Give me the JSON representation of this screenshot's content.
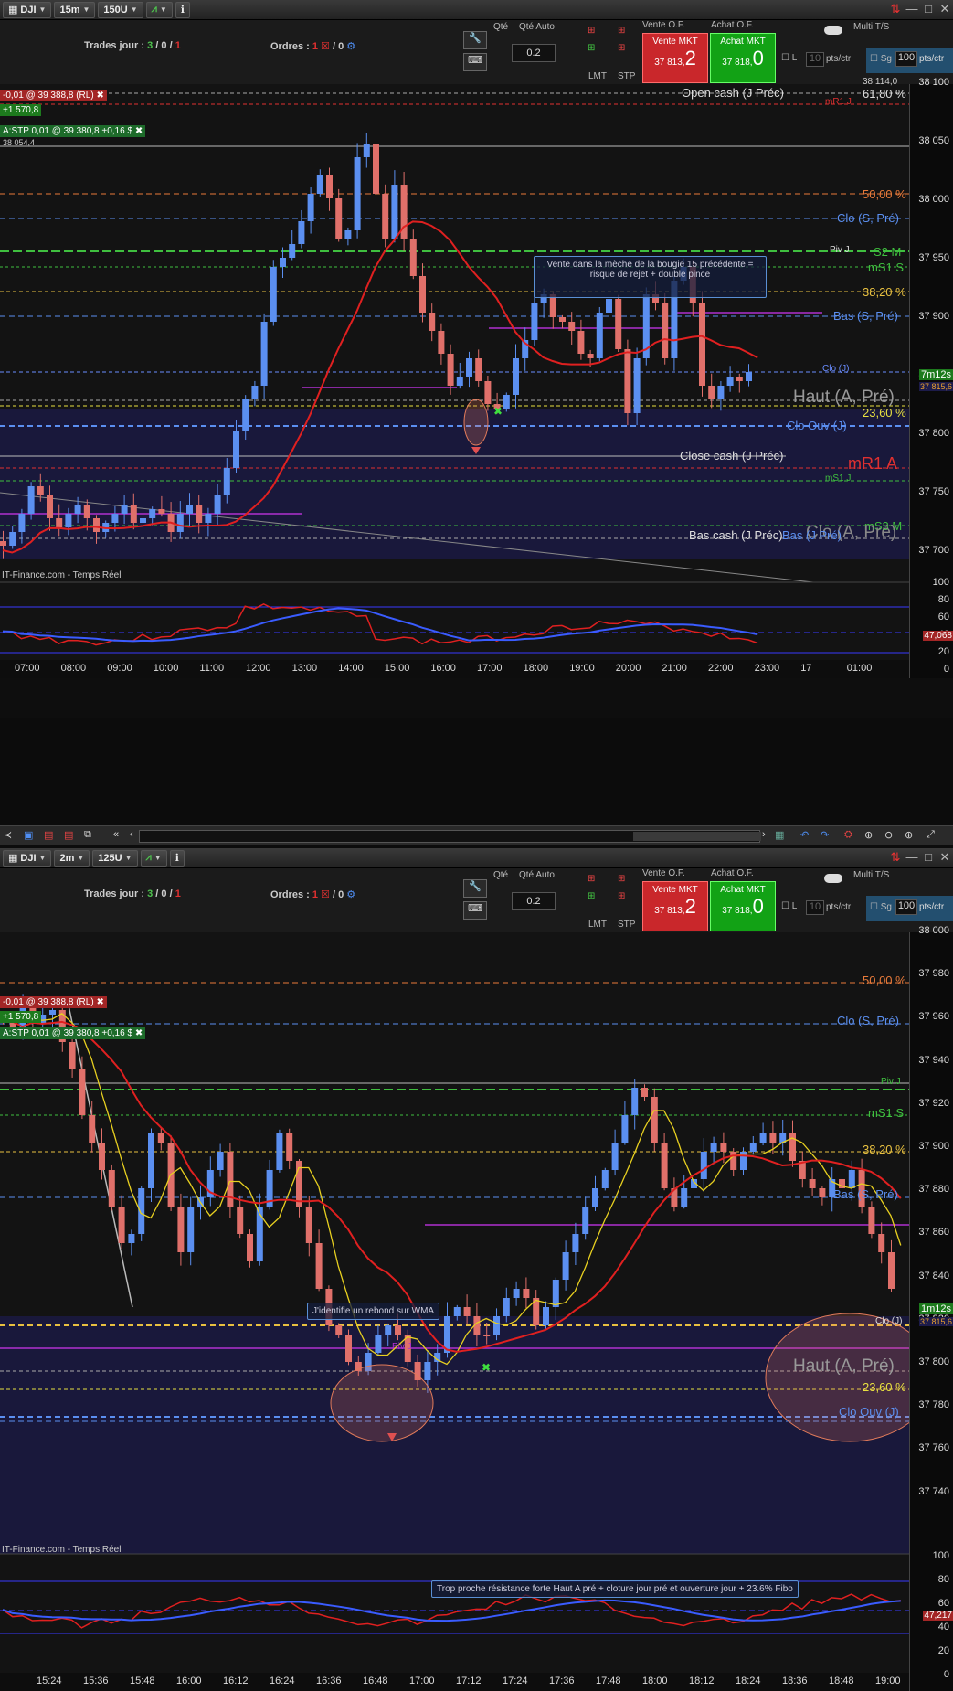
{
  "panes": [
    {
      "id": "top",
      "symbol": "DJI",
      "timeframe": "15m",
      "units": "150U",
      "trades_label": "Trades jour :",
      "trades_val1": "3",
      "trades_val2": "0",
      "trades_val3": "1",
      "orders_label": "Ordres :",
      "orders_val1": "1",
      "orders_val2": "0",
      "qty_label": "Qté",
      "qty_auto_label": "Qté Auto",
      "qty_value": "0.2",
      "lmt": "LMT",
      "stp": "STP",
      "vente_of": "Vente O.F.",
      "achat_of": "Achat O.F.",
      "vente_mkt": "Vente MKT",
      "achat_mkt": "Achat MKT",
      "vente_price": "37 813,",
      "vente_big": "2",
      "achat_price": "37 818,",
      "achat_big": "0",
      "multi": "Multi T/S",
      "l_label": "L",
      "l_val": "10",
      "pts": "pts/ctr",
      "sg": "Sg",
      "sg_val": "100",
      "pos1": "-0,01 @ 39 388,8 (RL)",
      "pos2": "+1 570,8",
      "pos3": "A:STP 0,01 @ 39 380,8",
      "pos3b": "+0,16 $",
      "pos4": "38 054,4",
      "price_ticks": [
        "38 100",
        "38 050",
        "38 000",
        "37 950",
        "37 900",
        "37 850",
        "37 800",
        "37 750",
        "37 700",
        "37 650"
      ],
      "levels": {
        "open_cash": "Open cash (J Préc)",
        "fib618": "61,80 %",
        "mr1j": "mR1 J",
        "fib50": "50,00 %",
        "clo_s": "Clo (S, Pré)",
        "pivj": "Piv J",
        "s2m": "S2 M",
        "ms1s": "mS1 S",
        "fib382": "38,20 %",
        "bas_s": "Bas (S, Pré)",
        "cloj": "Clo (J)",
        "haut_a": "Haut (A, Pré)",
        "fib236": "23,60 %",
        "clo_ouv": "Clo Ouv (J)",
        "close_cash": "Close cash (J Préc)",
        "mr1a": "mR1 A",
        "ms1j": "mS1 J",
        "ms3m": "mS3 M",
        "bas_cash": "Bas cash (J Préc)",
        "bas_j": "Bas (J Pré)",
        "clo_a": "Clo (A, Pré)",
        "price_tag": "37 815,6",
        "timer": "7m12s",
        "top_val": "38 114,0"
      },
      "note": "Vente dans la mèche de la bougie 15 précédente = risque de rejet + double pince",
      "credit": "IT-Finance.com - Temps Réel",
      "ind_ticks": [
        "100",
        "80",
        "60",
        "40",
        "20",
        "0"
      ],
      "ind_val": "47,068",
      "x_ticks": [
        "07:00",
        "08:00",
        "09:00",
        "10:00",
        "11:00",
        "12:00",
        "13:00",
        "14:00",
        "15:00",
        "16:00",
        "17:00",
        "18:00",
        "19:00",
        "20:00",
        "21:00",
        "22:00",
        "23:00",
        "17",
        "01:00"
      ]
    },
    {
      "id": "bottom",
      "symbol": "DJI",
      "timeframe": "2m",
      "units": "125U",
      "trades_label": "Trades jour :",
      "trades_val1": "3",
      "trades_val2": "0",
      "trades_val3": "1",
      "orders_label": "Ordres :",
      "orders_val1": "1",
      "orders_val2": "0",
      "qty_label": "Qté",
      "qty_auto_label": "Qté Auto",
      "qty_value": "0.2",
      "lmt": "LMT",
      "stp": "STP",
      "vente_of": "Vente O.F.",
      "achat_of": "Achat O.F.",
      "vente_mkt": "Vente MKT",
      "achat_mkt": "Achat MKT",
      "vente_price": "37 813,",
      "vente_big": "2",
      "achat_price": "37 818,",
      "achat_big": "0",
      "multi": "Multi T/S",
      "l_label": "L",
      "l_val": "10",
      "pts": "pts/ctr",
      "sg": "Sg",
      "sg_val": "100",
      "pos1": "-0,01 @ 39 388,8 (RL)",
      "pos2": "+1 570,8",
      "pos3": "A:STP 0,01 @ 39 380,8",
      "pos3b": "+0,16 $",
      "pos4": "",
      "price_ticks": [
        "38 000",
        "37 980",
        "37 960",
        "37 940",
        "37 920",
        "37 900",
        "37 880",
        "37 860",
        "37 840",
        "37 820",
        "37 800",
        "37 780",
        "37 760",
        "37 740"
      ],
      "levels": {
        "fib50": "50,00 %",
        "clo_s": "Clo (S, Pré)",
        "pivj": "Piv J",
        "ms1s": "mS1 S",
        "fib382": "38,20 %",
        "bas_s": "Bas (S, Pré)",
        "cloj": "Clo (J)",
        "haut_a": "Haut (A, Pré)",
        "fib236": "23,60 %",
        "clo_ouv": "Clo Ouv (J)",
        "price_tag": "37 815,6",
        "timer": "1m12s",
        "piv": "Piv J"
      },
      "note1": "J'identifie un rebond sur WMA",
      "note2": "Trop proche résistance forte Haut A pré + cloture jour pré et ouverture jour + 23.6% Fibo",
      "credit": "IT-Finance.com - Temps Réel",
      "ind_ticks": [
        "100",
        "80",
        "60",
        "40",
        "20",
        "0"
      ],
      "ind_val": "47,217",
      "x_ticks": [
        "15:24",
        "15:36",
        "15:48",
        "16:00",
        "16:12",
        "16:24",
        "16:36",
        "16:48",
        "17:00",
        "17:12",
        "17:24",
        "17:36",
        "17:48",
        "18:00",
        "18:12",
        "18:24",
        "18:36",
        "18:48",
        "19:00"
      ]
    }
  ],
  "toolbar_mid": {
    "scroll_label": "navigation toolbar"
  },
  "colors": {
    "bull": "#5b8ff0",
    "bear": "#e0706a",
    "ma_red": "#e02020",
    "ma_yellow": "#e8d020",
    "blue_line": "#3a5cff",
    "zone": "#1c1b4a"
  }
}
